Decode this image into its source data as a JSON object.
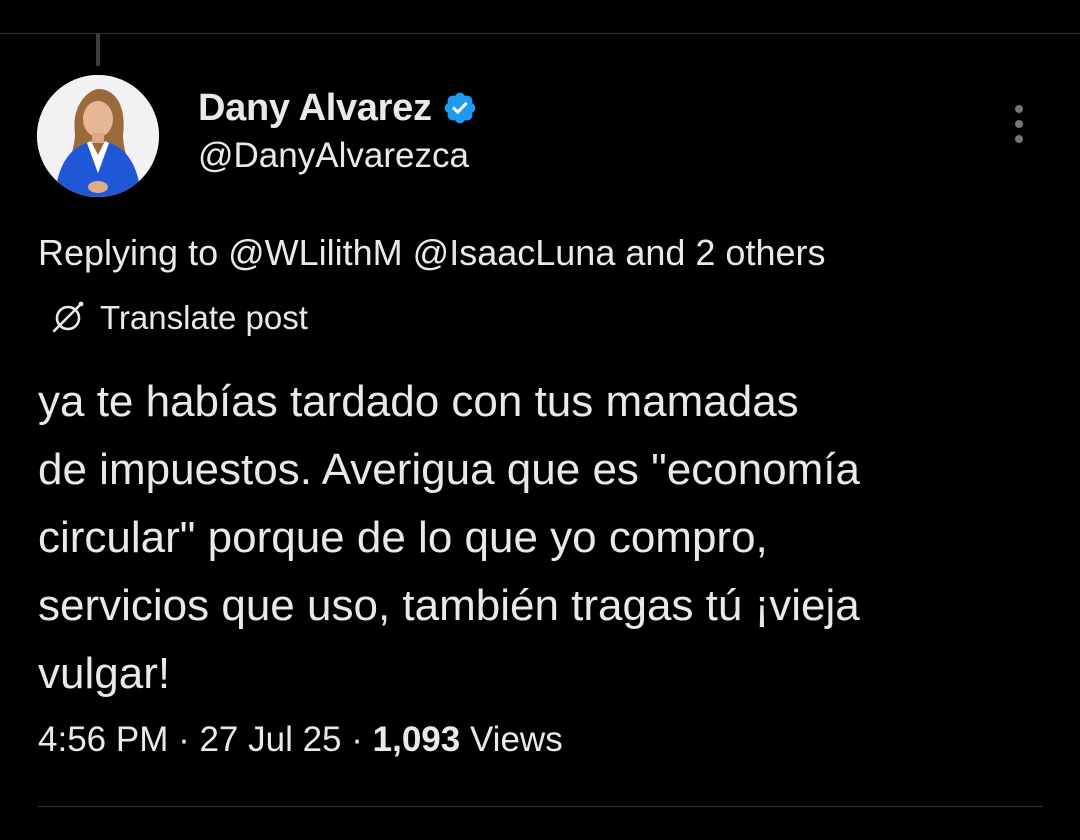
{
  "post": {
    "author": {
      "display_name": "Dany Alvarez",
      "handle": "@DanyAlvarezca",
      "verified": true,
      "verified_icon": "verified-badge-icon",
      "avatar": "profile-photo"
    },
    "more_icon": "more-vertical-icon",
    "reply_context": "Replying to @WLilithM @IsaacLuna and 2 others",
    "translate": {
      "icon": "translate-globe-icon",
      "label": "Translate post"
    },
    "text": "ya te habías tardado con tus mamadas\nde impuestos. Averigua que es \"economía\ncircular\" porque de lo que yo compro,\nservicios que uso, también tragas tú ¡vieja\nvulgar!",
    "meta": {
      "time": "4:56 PM",
      "separator": " · ",
      "date": "27 Jul 25",
      "views_count": "1,093",
      "views_label": " Views"
    }
  },
  "colors": {
    "background": "#000000",
    "text_primary": "#e7e9ea",
    "text_secondary": "#71767b",
    "verified_blue": "#1d9bf0",
    "divider": "#2f3336"
  }
}
